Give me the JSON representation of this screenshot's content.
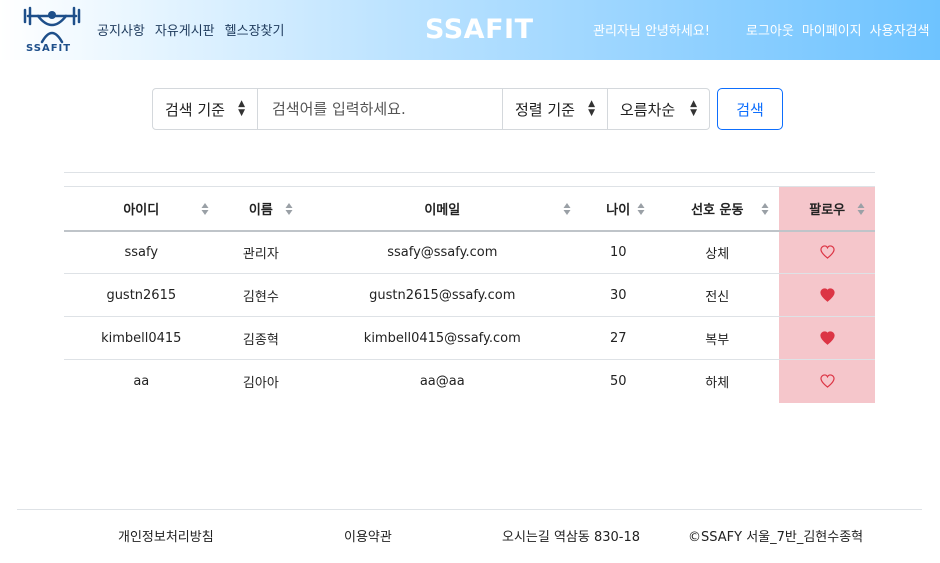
{
  "header": {
    "logo_text": "SSAFIT",
    "nav_left": [
      "공지사항",
      "자유게시판",
      "헬스장찾기"
    ],
    "brand": "SSAFIT",
    "greeting": "관리자님 안녕하세요!",
    "nav_right": [
      "로그아웃",
      "마이페이지",
      "사용자검색"
    ]
  },
  "search": {
    "criteria_label": "검색 기준",
    "placeholder": "검색어를 입력하세요.",
    "sort_label": "정렬 기준",
    "order_label": "오름차순",
    "button_label": "검색"
  },
  "table": {
    "columns": [
      "아이디",
      "이름",
      "이메일",
      "나이",
      "선호 운동",
      "팔로우"
    ],
    "rows": [
      {
        "id": "ssafy",
        "name": "관리자",
        "email": "ssafy@ssafy.com",
        "age": "10",
        "sport": "상체",
        "followed": false
      },
      {
        "id": "gustn2615",
        "name": "김현수",
        "email": "gustn2615@ssafy.com",
        "age": "30",
        "sport": "전신",
        "followed": true
      },
      {
        "id": "kimbell0415",
        "name": "김종혁",
        "email": "kimbell0415@ssafy.com",
        "age": "27",
        "sport": "복부",
        "followed": true
      },
      {
        "id": "aa",
        "name": "김아아",
        "email": "aa@aa",
        "age": "50",
        "sport": "하체",
        "followed": false
      }
    ]
  },
  "footer": {
    "privacy": "개인정보처리방침",
    "terms": "이용약관",
    "address": "오시는길 역삼동 830-18",
    "copyright": "©SSAFY 서울_7반_김현수종혁"
  },
  "colors": {
    "accent": "#0d6efd",
    "follow_column_bg": "#f5c6cb",
    "heart": "#dc3545"
  }
}
